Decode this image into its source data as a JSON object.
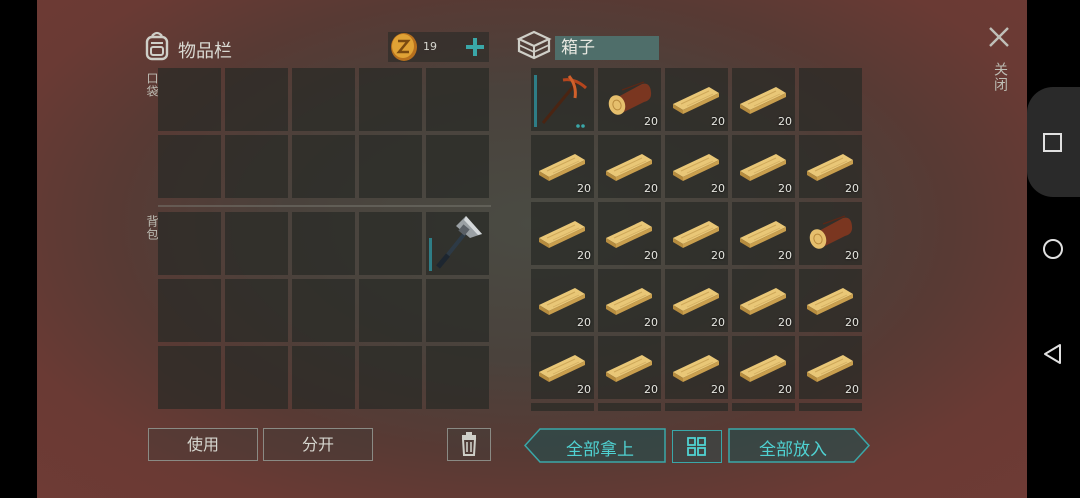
{
  "inventory": {
    "title": "物品栏",
    "coins": "19",
    "pocket_label": "口袋",
    "backpack_label": "背包",
    "use_label": "使用",
    "split_label": "分开"
  },
  "chest": {
    "title": "箱子",
    "take_all_label": "全部拿上",
    "put_all_label": "全部放入"
  },
  "close_label": "关闭",
  "backpack_slots": [
    {
      "item": "empty"
    },
    {
      "item": "empty"
    },
    {
      "item": "empty"
    },
    {
      "item": "empty"
    },
    {
      "item": "hatchet",
      "durability": 0.6
    },
    {
      "item": "empty"
    },
    {
      "item": "empty"
    },
    {
      "item": "empty"
    },
    {
      "item": "empty"
    },
    {
      "item": "empty"
    },
    {
      "item": "empty"
    },
    {
      "item": "empty"
    },
    {
      "item": "empty"
    },
    {
      "item": "empty"
    },
    {
      "item": "empty"
    }
  ],
  "chest_slots": [
    {
      "item": "pickaxe",
      "durability": 0.95
    },
    {
      "item": "log",
      "count": "20"
    },
    {
      "item": "plank",
      "count": "20"
    },
    {
      "item": "plank",
      "count": "20"
    },
    {
      "item": "empty"
    },
    {
      "item": "plank",
      "count": "20"
    },
    {
      "item": "plank",
      "count": "20"
    },
    {
      "item": "plank",
      "count": "20"
    },
    {
      "item": "plank",
      "count": "20"
    },
    {
      "item": "plank",
      "count": "20"
    },
    {
      "item": "plank",
      "count": "20"
    },
    {
      "item": "plank",
      "count": "20"
    },
    {
      "item": "plank",
      "count": "20"
    },
    {
      "item": "plank",
      "count": "20"
    },
    {
      "item": "log",
      "count": "20"
    },
    {
      "item": "plank",
      "count": "20"
    },
    {
      "item": "plank",
      "count": "20"
    },
    {
      "item": "plank",
      "count": "20"
    },
    {
      "item": "plank",
      "count": "20"
    },
    {
      "item": "plank",
      "count": "20"
    },
    {
      "item": "plank",
      "count": "20"
    },
    {
      "item": "plank",
      "count": "20"
    },
    {
      "item": "plank",
      "count": "20"
    },
    {
      "item": "plank",
      "count": "20"
    },
    {
      "item": "plank",
      "count": "20"
    }
  ],
  "colors": {
    "accent_teal": "#4fd2d2",
    "durability": "#2e7d86",
    "coin": "#d8902a"
  }
}
